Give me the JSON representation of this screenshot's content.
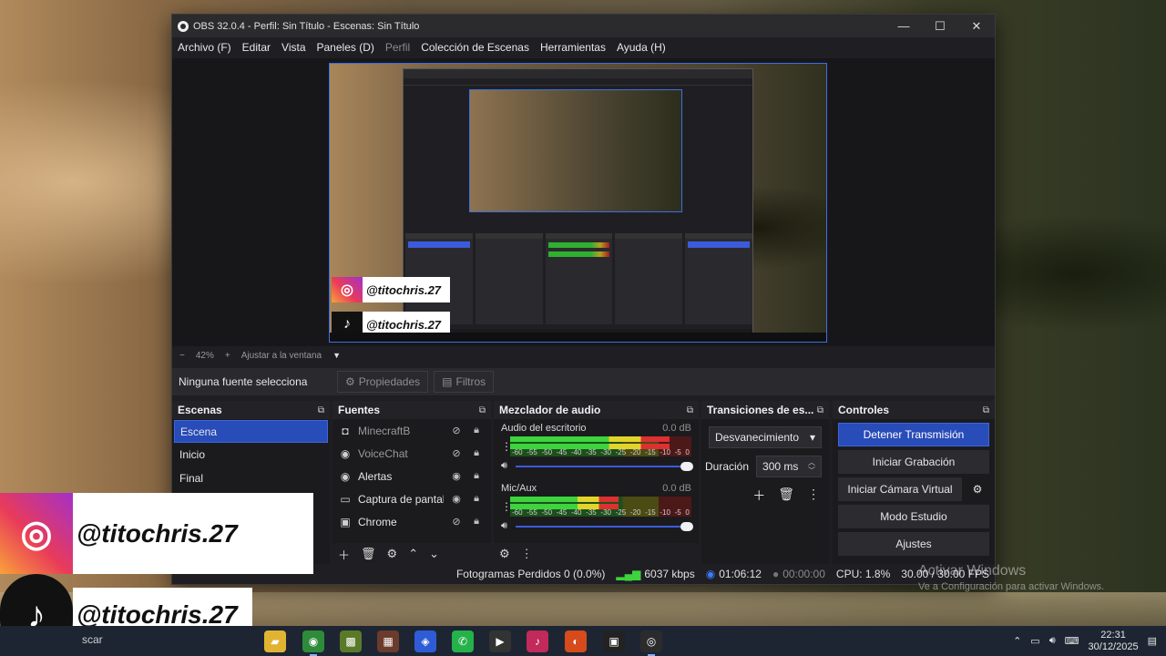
{
  "window": {
    "title": "OBS 32.0.4 - Perfil: Sin Título - Escenas: Sin Título",
    "minimize": "—",
    "maximize": "☐",
    "close": "✕"
  },
  "menu": {
    "items": [
      "Archivo (F)",
      "Editar",
      "Vista",
      "Paneles (D)",
      "Perfil",
      "Colección de Escenas",
      "Herramientas",
      "Ayuda (H)"
    ]
  },
  "preview": {
    "zoom_minus": "−",
    "zoom_level": "42%",
    "zoom_plus": "+",
    "fit_label": "Ajustar a la ventana",
    "handle_instagram": "@titochris.27",
    "handle_tiktok": "@titochris.27"
  },
  "source_toolbar": {
    "no_source": "Ninguna fuente selecciona",
    "properties": "Propiedades",
    "filters": "Filtros"
  },
  "scenes": {
    "title": "Escenas",
    "items": [
      "Escena",
      "Inicio",
      "Final"
    ],
    "selected": "Escena"
  },
  "sources": {
    "title": "Fuentes",
    "items": [
      {
        "name": "MinecraftB",
        "icon": "gamepad-icon",
        "visible": false
      },
      {
        "name": "VoiceChat",
        "icon": "browser-icon",
        "visible": false
      },
      {
        "name": "Alertas",
        "icon": "browser-icon",
        "visible": true
      },
      {
        "name": "Captura de pantalla",
        "icon": "monitor-icon",
        "visible": true
      },
      {
        "name": "Chrome",
        "icon": "window-icon",
        "visible": false
      }
    ]
  },
  "mixer": {
    "title": "Mezclador de audio",
    "channels": [
      {
        "name": "Audio del escritorio",
        "db": "0.0 dB",
        "level": 0.88
      },
      {
        "name": "Mic/Aux",
        "db": "0.0 dB",
        "level": 0.6
      }
    ],
    "ticks": [
      "-60",
      "-55",
      "-50",
      "-45",
      "-40",
      "-35",
      "-30",
      "-25",
      "-20",
      "-15",
      "-10",
      "-5",
      "0"
    ]
  },
  "transitions": {
    "title": "Transiciones de es...",
    "selected": "Desvanecimiento",
    "duration_label": "Duración",
    "duration_value": "300 ms"
  },
  "controls": {
    "title": "Controles",
    "stop_stream": "Detener Transmisión",
    "start_recording": "Iniciar Grabación",
    "start_virtual_cam": "Iniciar Cámara Virtual",
    "studio_mode": "Modo Estudio",
    "settings": "Ajustes"
  },
  "status": {
    "dropped_frames": "Fotogramas Perdidos 0 (0.0%)",
    "bitrate": "6037 kbps",
    "stream_time": "01:06:12",
    "rec_time": "00:00:00",
    "cpu": "CPU: 1.8%",
    "fps": "30.00 / 30.00 FPS"
  },
  "watermark": {
    "line1": "Activar Windows",
    "line2": "Ve a Configuración para activar Windows."
  },
  "overlay": {
    "instagram": "@titochris.27",
    "tiktok": "@titochris.27"
  },
  "taskbar": {
    "search": "scar",
    "time": "22:31",
    "date": "30/12/2025"
  },
  "colors": {
    "accent": "#284cb8",
    "dock_bg": "#1f1f23",
    "meter_green": "#3dd43d"
  }
}
